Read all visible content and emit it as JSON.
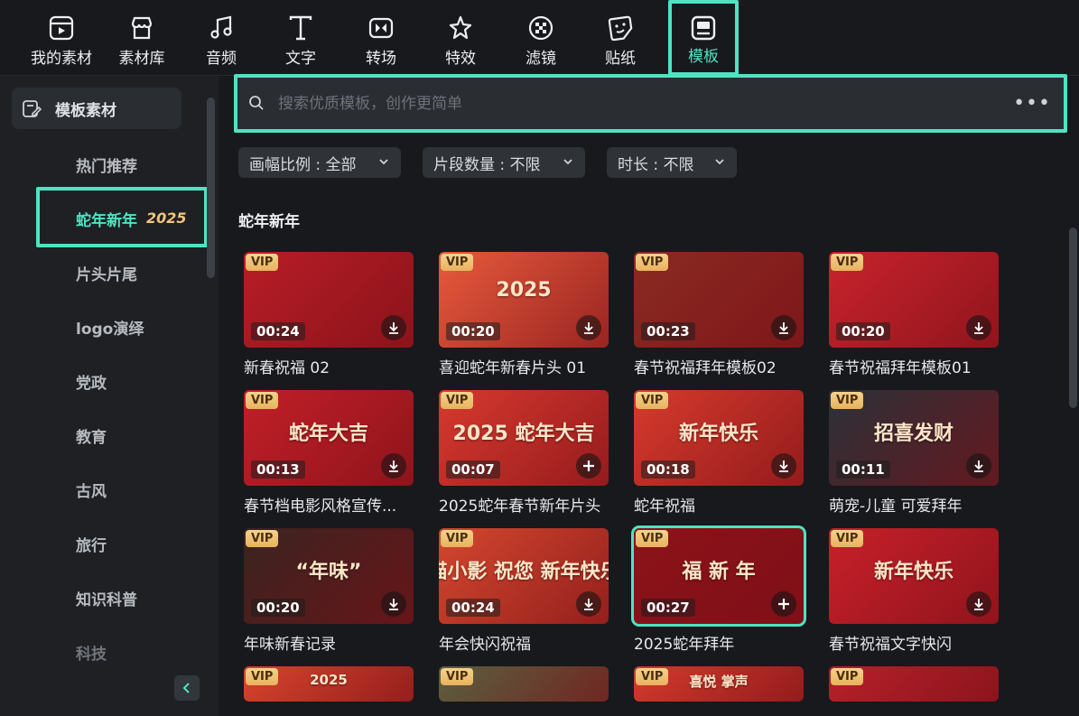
{
  "toolbar": {
    "tabs": [
      {
        "label": "我的素材",
        "icon": "media-icon"
      },
      {
        "label": "素材库",
        "icon": "store-icon"
      },
      {
        "label": "音频",
        "icon": "music-icon"
      },
      {
        "label": "文字",
        "icon": "text-icon"
      },
      {
        "label": "转场",
        "icon": "transition-icon"
      },
      {
        "label": "特效",
        "icon": "effects-icon"
      },
      {
        "label": "滤镜",
        "icon": "filter-icon"
      },
      {
        "label": "贴纸",
        "icon": "sticker-icon"
      },
      {
        "label": "模板",
        "icon": "template-icon"
      }
    ],
    "active_index": 8
  },
  "sidebar": {
    "header": "模板素材",
    "items": [
      "热门推荐",
      "蛇年新年",
      "片头片尾",
      "logo演绎",
      "党政",
      "教育",
      "古风",
      "旅行",
      "知识科普",
      "科技"
    ],
    "selected_index": 1,
    "selected_badge": "2025"
  },
  "search": {
    "placeholder": "搜索优质模板，创作更简单",
    "more": "•••"
  },
  "filters": [
    {
      "label": "画幅比例 : 全部"
    },
    {
      "label": "片段数量 : 不限"
    },
    {
      "label": "时长 : 不限"
    }
  ],
  "section": {
    "title": "蛇年新年"
  },
  "vip_label": "VIP",
  "cards": [
    {
      "title": "新春祝福 02",
      "duration": "00:24",
      "action": "download",
      "bg": "#b81d26",
      "deco": ""
    },
    {
      "title": "喜迎蛇年新春片头 01",
      "duration": "00:20",
      "action": "download",
      "bg": "#e85a3c",
      "deco": "2025"
    },
    {
      "title": "春节祝福拜年模板02",
      "duration": "00:23",
      "action": "download",
      "bg": "#8a2a22",
      "deco": ""
    },
    {
      "title": "春节祝福拜年模板01",
      "duration": "00:20",
      "action": "download",
      "bg": "#c8232c",
      "deco": ""
    },
    {
      "title": "春节档电影风格宣传...",
      "duration": "00:13",
      "action": "download",
      "bg": "#c21f28",
      "deco": "蛇年大吉"
    },
    {
      "title": "2025蛇年春节新年片头",
      "duration": "00:07",
      "action": "add",
      "bg": "#d8392e",
      "deco": "2025 蛇年大吉"
    },
    {
      "title": "蛇年祝福",
      "duration": "00:18",
      "action": "download",
      "bg": "#d63a2c",
      "deco": "新年快乐"
    },
    {
      "title": "萌宠-儿童 可爱拜年",
      "duration": "00:11",
      "action": "download",
      "bg": "#2c3138",
      "deco": "招喜发财"
    },
    {
      "title": "年味新春记录",
      "duration": "00:20",
      "action": "download",
      "bg": "#3a2420",
      "deco": "“年味”"
    },
    {
      "title": "年会快闪祝福",
      "duration": "00:24",
      "action": "download",
      "bg": "#d4472e",
      "deco": "喵小影 祝您 新年快乐"
    },
    {
      "title": "2025蛇年拜年",
      "duration": "00:27",
      "action": "add",
      "bg": "#8c1219",
      "deco": "福 新 年"
    },
    {
      "title": "春节祝福文字快闪",
      "duration": "",
      "action": "download",
      "bg": "#c8202a",
      "deco": "新年快乐"
    },
    {
      "title": "",
      "duration": "",
      "action": "",
      "bg": "#d8442c",
      "deco": "2025"
    },
    {
      "title": "",
      "duration": "",
      "action": "",
      "bg": "#5a6040",
      "deco": ""
    },
    {
      "title": "",
      "duration": "",
      "action": "",
      "bg": "#d43a2c",
      "deco": "喜悦 掌声"
    },
    {
      "title": "",
      "duration": "",
      "action": "",
      "bg": "#b8202a",
      "deco": ""
    }
  ],
  "selected_card_index": 10,
  "colors": {
    "accent": "#4fe3c1",
    "bg": "#17191d",
    "panel": "#1e2024"
  }
}
